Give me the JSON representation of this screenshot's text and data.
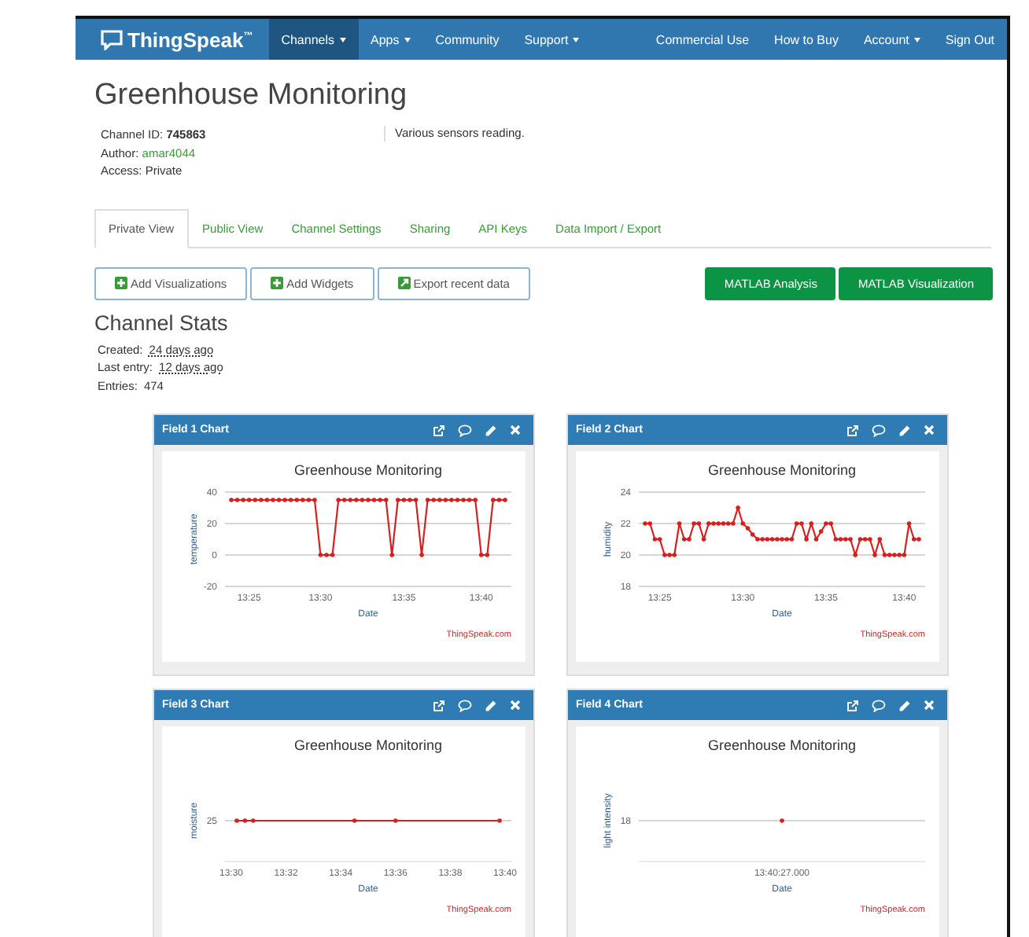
{
  "navbar": {
    "logo": "ThingSpeak$^{™}$",
    "left_items": [
      {
        "label": "Channels",
        "dropdown": true,
        "selected": true
      },
      {
        "label": "Apps",
        "dropdown": true,
        "selected": false
      },
      {
        "label": "Community",
        "dropdown": false,
        "selected": false
      },
      {
        "label": "Support",
        "dropdown": true,
        "selected": false
      }
    ],
    "right_items": [
      {
        "label": "Commercial Use",
        "dropdown": false,
        "selected": false
      },
      {
        "label": "How to Buy",
        "dropdown": false,
        "selected": false
      },
      {
        "label": "Account",
        "dropdown": true,
        "selected": false
      },
      {
        "label": "Sign Out",
        "dropdown": false,
        "selected": false
      }
    ]
  },
  "channel": {
    "title": "Greenhouse Monitoring",
    "id_label": "Channel ID:",
    "id": "745863",
    "author_label": "Author:",
    "author": "amar4044",
    "access": "Access: Private",
    "description": "Various sensors reading."
  },
  "tabs": [
    {
      "label": "Private View",
      "selected": true
    },
    {
      "label": "Public View",
      "selected": false
    },
    {
      "label": "Channel Settings",
      "selected": false
    },
    {
      "label": "Sharing",
      "selected": false
    },
    {
      "label": "API Keys",
      "selected": false
    },
    {
      "label": "Data Import / Export",
      "selected": false
    }
  ],
  "actions": [
    {
      "label": "Add Visualizations",
      "kind": "add"
    },
    {
      "label": "Add Widgets",
      "kind": "add"
    },
    {
      "label": "Export recent data",
      "kind": "export"
    }
  ],
  "matlab_buttons": [
    "MATLAB Analysis",
    "MATLAB Visualization"
  ],
  "stats": {
    "title": "Channel Stats",
    "items": [
      {
        "label": "Created:",
        "value": "24 days ago",
        "kind": "time"
      },
      {
        "label": "Last entry:",
        "value": "12 days ago",
        "kind": "time"
      },
      {
        "label": "Entries:",
        "value": "474",
        "kind": "count"
      }
    ]
  },
  "charts": [
    {
      "header": "Field 1 Chart",
      "credit": "ThingSpeak.com",
      "kind": "chart",
      "chart_data": {
        "type": "line",
        "title": "Greenhouse Monitoring",
        "xlabel": "Date",
        "ylabel": "temperature",
        "categories": [
          null,
          null,
          null,
          "13:25",
          null,
          null,
          null,
          null,
          null,
          null,
          null,
          null,
          null,
          null,
          null,
          "13:30",
          null,
          null,
          null,
          null,
          null,
          null,
          null,
          null,
          null,
          null,
          null,
          null,
          null,
          "13:35",
          null,
          null,
          null,
          null,
          null,
          null,
          null,
          null,
          null,
          null,
          null,
          null,
          "13:40",
          null,
          null,
          null,
          null
        ],
        "series": [
          {
            "color": "#d62020",
            "values": [
              35,
              35,
              35,
              35,
              35,
              35,
              35,
              35,
              35,
              35,
              35,
              35,
              35,
              35,
              35,
              0,
              0,
              0,
              35,
              35,
              35,
              35,
              35,
              35,
              35,
              35,
              35,
              0,
              35,
              35,
              35,
              35,
              0,
              35,
              35,
              35,
              35,
              35,
              35,
              35,
              35,
              35,
              0,
              0,
              35,
              35,
              35
            ]
          }
        ],
        "ylim": [
          -20,
          40
        ],
        "yticks": [
          -20,
          0,
          20,
          40
        ]
      }
    },
    {
      "header": "Field 2 Chart",
      "credit": "ThingSpeak.com",
      "kind": "chart",
      "chart_data": {
        "type": "line",
        "title": "Greenhouse Monitoring",
        "xlabel": "Date",
        "ylabel": "humidity",
        "categories": [
          null,
          null,
          null,
          "13:25",
          null,
          null,
          null,
          null,
          null,
          null,
          null,
          null,
          null,
          null,
          null,
          null,
          null,
          null,
          null,
          null,
          "13:30",
          null,
          null,
          null,
          null,
          null,
          null,
          null,
          null,
          null,
          null,
          null,
          null,
          null,
          null,
          null,
          null,
          "13:35",
          null,
          null,
          null,
          null,
          null,
          null,
          null,
          null,
          null,
          null,
          null,
          null,
          null,
          null,
          null,
          "13:40",
          null,
          null,
          null
        ],
        "series": [
          {
            "color": "#d62020",
            "values": [
              22,
              22,
              21,
              21,
              20,
              20,
              20,
              22,
              21,
              21,
              22,
              22,
              21,
              22,
              22,
              22,
              22,
              22,
              22,
              23,
              22,
              21.7,
              21.3,
              21,
              21,
              21,
              21,
              21,
              21,
              21,
              21,
              22,
              22,
              21,
              22,
              21,
              21.5,
              22,
              22,
              21,
              21,
              21,
              21,
              20,
              21,
              21,
              21,
              20,
              21,
              20,
              20,
              20,
              20,
              20,
              22,
              21,
              21
            ]
          }
        ],
        "ylim": [
          18,
          24
        ],
        "yticks": [
          18,
          20,
          22,
          24
        ]
      }
    },
    {
      "header": "Field 3 Chart",
      "credit": "ThingSpeak.com",
      "kind": "sketch",
      "title": "Greenhouse Monitoring",
      "xlabel": "Date",
      "ylabel": "moisture",
      "y_label": "25",
      "x_labels": [
        "13:30",
        "13:32",
        "13:34",
        "13:36",
        "13:38",
        "13:40"
      ]
    },
    {
      "header": "Field 4 Chart",
      "credit": "ThingSpeak.com",
      "kind": "sketch",
      "title": "Greenhouse Monitoring",
      "xlabel": "Date",
      "ylabel": "light intensity",
      "y_label": "18",
      "x_labels": [
        "13:40:27.000"
      ]
    }
  ]
}
